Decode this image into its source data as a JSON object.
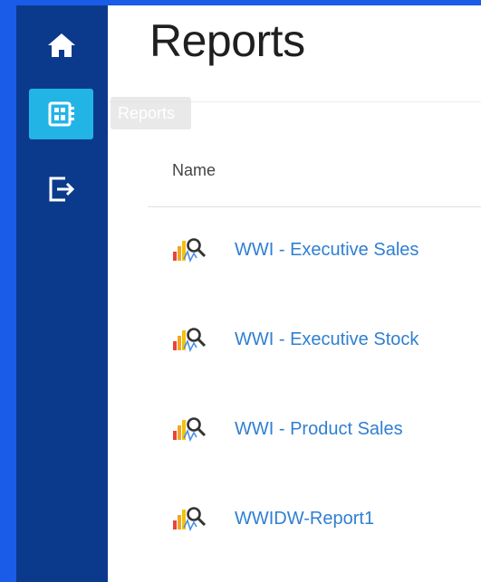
{
  "sidebar": {
    "items": [
      {
        "name": "home",
        "icon": "home-icon",
        "active": false
      },
      {
        "name": "reports",
        "icon": "reports-icon",
        "active": true
      },
      {
        "name": "sign-out",
        "icon": "sign-out-icon",
        "active": false
      }
    ],
    "tooltip": "Reports"
  },
  "main": {
    "title": "Reports",
    "columns": [
      "Name"
    ],
    "reports": [
      {
        "name": "WWI - Executive Sales",
        "icon": "report-icon"
      },
      {
        "name": "WWI - Executive Stock",
        "icon": "report-icon"
      },
      {
        "name": "WWI - Product Sales",
        "icon": "report-icon"
      },
      {
        "name": "WWIDW-Report1",
        "icon": "report-icon"
      }
    ]
  },
  "colors": {
    "background": "#1a5be8",
    "sidebar": "#0b3a8c",
    "active_nav": "#23b4e6",
    "link": "#2f7fd1"
  }
}
